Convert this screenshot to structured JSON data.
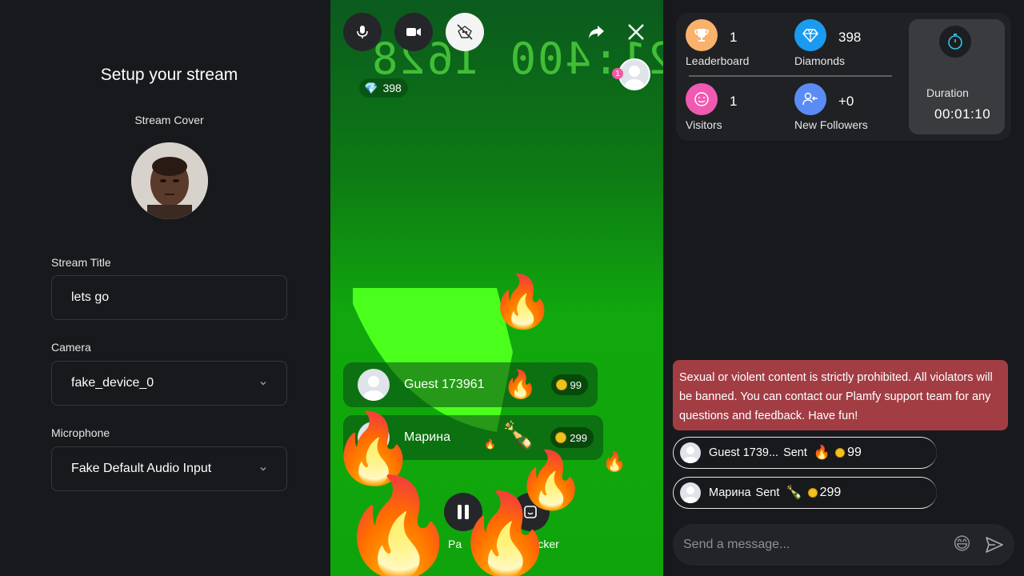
{
  "setup": {
    "title": "Setup your stream",
    "cover_label": "Stream Cover",
    "title_label": "Stream Title",
    "title_value": "lets go",
    "camera_label": "Camera",
    "camera_value": "fake_device_0",
    "mic_label": "Microphone",
    "mic_value": "Fake Default Audio Input"
  },
  "stream": {
    "clock_text": "21:400 1628",
    "diamonds": "398",
    "viewer_badge": "1",
    "gifts": [
      {
        "name": "Guest 173961",
        "amount": "99",
        "gift_icon": "fire"
      },
      {
        "name": "Марина",
        "amount": "299",
        "gift_icon": "champagne"
      }
    ],
    "pause_label": "Pa",
    "sticker_label": "Sticker"
  },
  "stats": {
    "leaderboard": {
      "value": "1",
      "label": "Leaderboard"
    },
    "diamonds": {
      "value": "398",
      "label": "Diamonds"
    },
    "visitors": {
      "value": "1",
      "label": "Visitors"
    },
    "followers": {
      "value": "+0",
      "label": "New Followers"
    },
    "duration": {
      "label": "Duration",
      "value": "00:01:10"
    }
  },
  "chat": {
    "notice": "Sexual or violent content is strictly prohibited. All violators will be banned. You can contact our Plamfy support team for any questions and feedback. Have fun!",
    "items": [
      {
        "name": "Guest 1739...",
        "sent": "Sent",
        "gift_icon": "🔥",
        "amount": "99"
      },
      {
        "name": "Марина",
        "sent": "Sent",
        "gift_icon": "🍾",
        "amount": "299"
      }
    ],
    "input_placeholder": "Send a message..."
  },
  "colors": {
    "leaderboard": "#f9b26b",
    "diamonds": "#1a9bf0",
    "visitors": "#f05ab2",
    "followers": "#5b8cf5",
    "notice": "#a23d44",
    "timer": "#35c4e8"
  }
}
